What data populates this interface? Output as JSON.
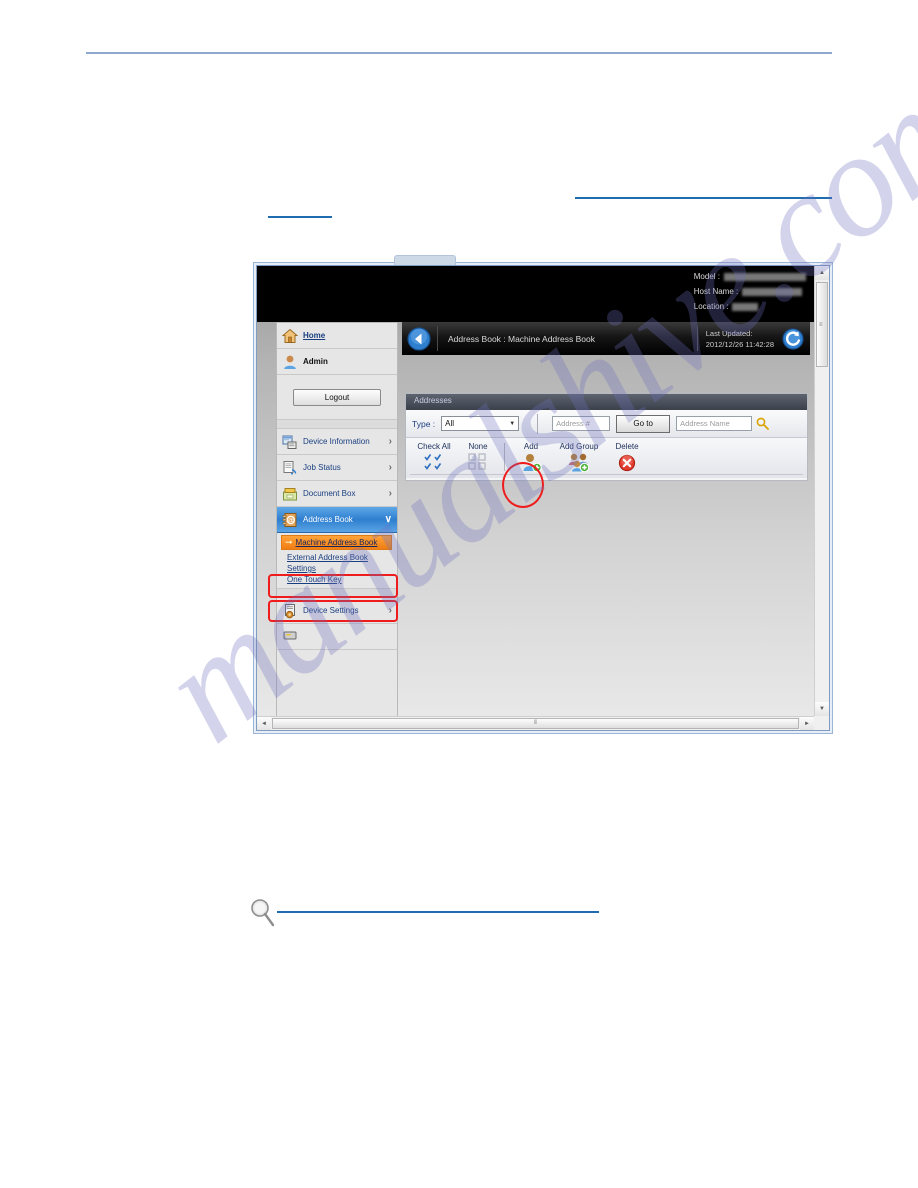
{
  "page": {
    "watermark": "manualshive.com"
  },
  "screenshot": {
    "device_header": {
      "model_label": "Model :",
      "host_name_label": "Host Name :",
      "location_label": "Location :",
      "model_value": "",
      "host_name_value": "",
      "location_value": ""
    },
    "sidebar": {
      "home_label": "Home",
      "user_label": "Admin",
      "logout_label": "Logout",
      "items": [
        {
          "label": "Device Information",
          "icon": "device-information-icon",
          "chevron": "›"
        },
        {
          "label": "Job Status",
          "icon": "job-status-icon",
          "chevron": "›"
        },
        {
          "label": "Document Box",
          "icon": "document-box-icon",
          "chevron": "›"
        },
        {
          "label": "Address Book",
          "icon": "address-book-icon",
          "chevron": "∨"
        },
        {
          "label": "Device Settings",
          "icon": "device-settings-icon",
          "chevron": "›"
        }
      ],
      "sub_items": [
        {
          "label": "Machine Address Book",
          "current": true
        },
        {
          "label": "External Address Book",
          "current": false
        },
        {
          "label": "Settings",
          "current": false
        },
        {
          "label": "One Touch Key",
          "current": false
        }
      ]
    },
    "titlebar": {
      "back_icon": "back-arrow-icon",
      "breadcrumb": "Address Book : Machine Address Book",
      "last_updated_label": "Last Updated:",
      "last_updated_value": "2012/12/26 11:42:28",
      "refresh_icon": "refresh-icon"
    },
    "panel": {
      "heading": "Addresses",
      "filter": {
        "type_label": "Type :",
        "type_value": "All",
        "type_options": [
          "All"
        ],
        "address_number_placeholder": "Address #",
        "address_number_value": "",
        "goto_label": "Go to",
        "address_name_placeholder": "Address Name",
        "address_name_value": "",
        "search_icon": "search-icon"
      },
      "actions": [
        {
          "label": "Check All",
          "icon": "check-all-icon"
        },
        {
          "label": "None",
          "icon": "check-none-icon"
        },
        {
          "label": "Add",
          "icon": "add-contact-icon"
        },
        {
          "label": "Add Group",
          "icon": "add-group-icon"
        },
        {
          "label": "Delete",
          "icon": "delete-icon"
        }
      ]
    },
    "scrollbars": {
      "vertical_up": "▲",
      "vertical_down": "▼",
      "vertical_grip": "≡",
      "horizontal_left": "◄",
      "horizontal_right": "►",
      "horizontal_grip": "⦀"
    }
  }
}
